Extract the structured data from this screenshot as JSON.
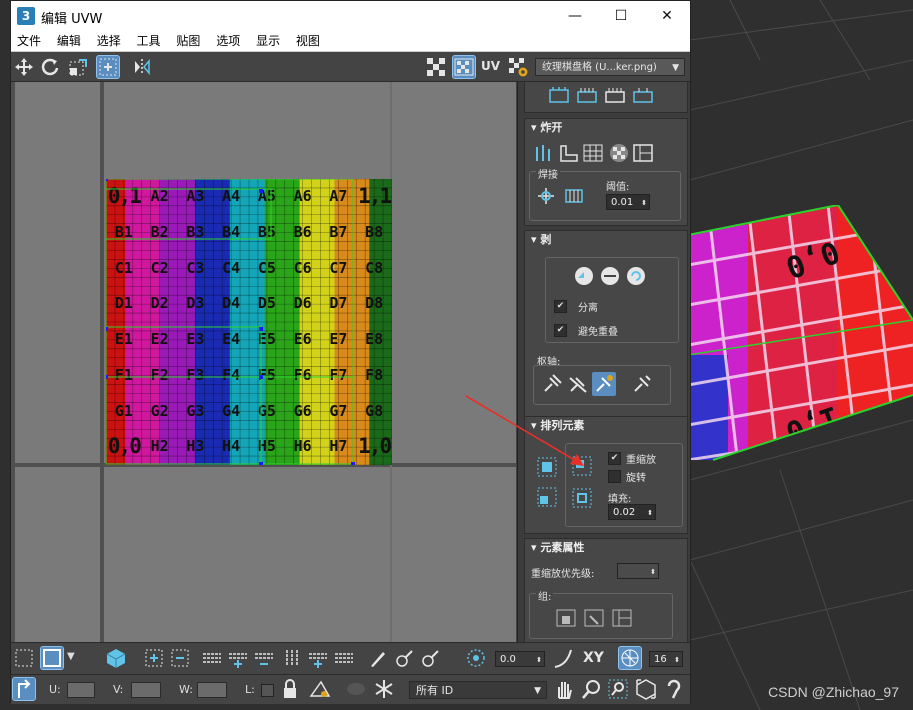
{
  "window": {
    "title": "编辑 UVW",
    "icon_label": "3",
    "controls": {
      "minimize": "—",
      "maximize": "☐",
      "close": "✕"
    }
  },
  "menu": [
    "文件",
    "编辑",
    "选择",
    "工具",
    "贴图",
    "选项",
    "显示",
    "视图"
  ],
  "toolbar": {
    "uv_label": "UV",
    "texture_dropdown": "纹理棋盘格 (U...ker.png)"
  },
  "checker": {
    "rows": [
      [
        "0,1",
        "A2",
        "A3",
        "A4",
        "A5",
        "A6",
        "A7",
        "1,1"
      ],
      [
        "B1",
        "B2",
        "B3",
        "B4",
        "B5",
        "B6",
        "B7",
        "B8"
      ],
      [
        "C1",
        "C2",
        "C3",
        "C4",
        "C5",
        "C6",
        "C7",
        "C8"
      ],
      [
        "D1",
        "D2",
        "D3",
        "D4",
        "D5",
        "D6",
        "D7",
        "D8"
      ],
      [
        "E1",
        "E2",
        "E3",
        "E4",
        "E5",
        "E6",
        "E7",
        "E8"
      ],
      [
        "F1",
        "F2",
        "F3",
        "F4",
        "F5",
        "F6",
        "F7",
        "F8"
      ],
      [
        "G1",
        "G2",
        "G3",
        "G4",
        "G5",
        "G6",
        "G7",
        "G8"
      ],
      [
        "0,0",
        "H2",
        "H3",
        "H4",
        "H5",
        "H6",
        "H7",
        "1,0"
      ]
    ],
    "column_colors": [
      "#cc1111",
      "#d0189e",
      "#9a1ab8",
      "#1a2bb3",
      "#14a6b8",
      "#2aa51a",
      "#d2d21a",
      "#d88a1a",
      "#1a6a1a"
    ]
  },
  "panel": {
    "explode": {
      "title": "炸开",
      "weld_label": "焊接",
      "threshold_label": "阈值:",
      "threshold_value": "0.01"
    },
    "peel": {
      "title": "剥",
      "detach_label": "分离",
      "detach_checked": "✔",
      "avoid_overlap_label": "避免重叠",
      "avoid_overlap_checked": "✔",
      "pivot_label": "枢轴:"
    },
    "arrange": {
      "title": "排列元素",
      "rescale_label": "重缩放",
      "rescale_checked": "✔",
      "rotate_label": "旋转",
      "rotate_checked": "",
      "padding_label": "填充:",
      "padding_value": "0.02"
    },
    "element_props": {
      "title": "元素属性",
      "rescale_priority_label": "重缩放优先级:",
      "group_label": "组:"
    }
  },
  "bottom1": {
    "spin_value": "0.0",
    "xy_label": "XY",
    "grid_value": "16"
  },
  "bottom2": {
    "u_label": "U:",
    "v_label": "V:",
    "w_label": "W:",
    "l_label": "L:",
    "id_dropdown": "所有 ID"
  },
  "watermark": "CSDN @Zhichao_97",
  "colors": {
    "accent": "#5a8ec0",
    "selection_green": "#2ad22a",
    "handle_blue": "#1a1aff"
  }
}
